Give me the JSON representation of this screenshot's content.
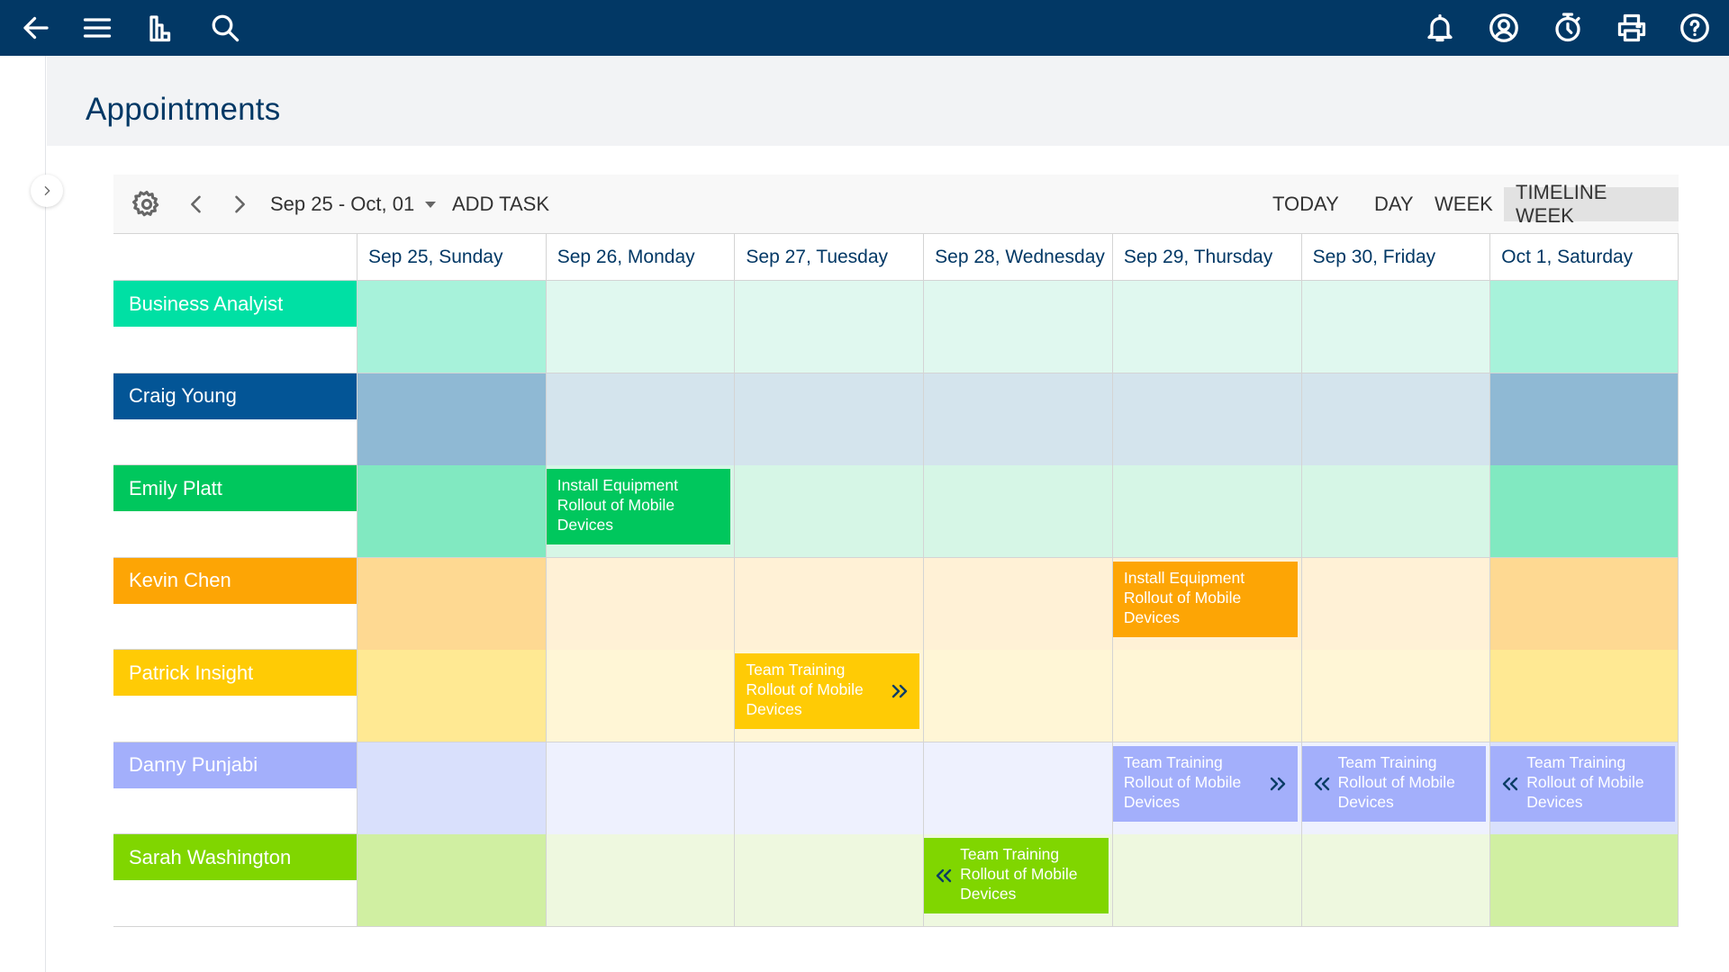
{
  "topbar": {
    "left_icons": [
      "back-arrow-icon",
      "menu-icon",
      "reports-icon",
      "search-icon"
    ],
    "right_icons": [
      "notifications-bell-icon",
      "user-profile-icon",
      "timer-icon",
      "print-icon",
      "help-icon"
    ]
  },
  "page": {
    "title": "Appointments"
  },
  "toolbar": {
    "date_range": "Sep 25 - Oct, 01",
    "add_task": "ADD TASK",
    "today": "TODAY",
    "views": [
      {
        "label": "DAY",
        "active": false
      },
      {
        "label": "WEEK",
        "active": false
      },
      {
        "label": "TIMELINE WEEK",
        "active": true
      }
    ]
  },
  "days": [
    "Sep 25, Sunday",
    "Sep 26, Monday",
    "Sep 27, Tuesday",
    "Sep 28, Wednesday",
    "Sep 29, Thursday",
    "Sep 30, Friday",
    "Oct 1, Saturday"
  ],
  "resources": [
    {
      "name": "Business Analyist",
      "color": "#00e0a4",
      "weekday_bg": "#e0f8ef",
      "weekend_bg": "#a7f2da"
    },
    {
      "name": "Craig Young",
      "color": "#035596",
      "weekday_bg": "#d4e4ed",
      "weekend_bg": "#8fb9d4"
    },
    {
      "name": "Emily Platt",
      "color": "#00c75d",
      "weekday_bg": "#d6f6e6",
      "weekend_bg": "#81e9c1"
    },
    {
      "name": "Kevin Chen",
      "color": "#fda505",
      "weekday_bg": "#fff1d6",
      "weekend_bg": "#fed992"
    },
    {
      "name": "Patrick Insight",
      "color": "#ffcb05",
      "weekday_bg": "#fff6d6",
      "weekend_bg": "#ffe993"
    },
    {
      "name": "Danny Punjabi",
      "color": "#a3affb",
      "weekday_bg": "#eef1fe",
      "weekend_bg": "#d9e0fc"
    },
    {
      "name": "Sarah Washington",
      "color": "#80d600",
      "weekday_bg": "#eef8df",
      "weekend_bg": "#d0efa2"
    }
  ],
  "events": [
    {
      "resource": 2,
      "day": 1,
      "line1": "Install Equipment",
      "line2": "Rollout of Mobile",
      "line3": "Devices",
      "continues_right": false,
      "continues_left": false
    },
    {
      "resource": 3,
      "day": 4,
      "line1": "Install Equipment",
      "line2": "Rollout of Mobile",
      "line3": "Devices",
      "continues_right": false,
      "continues_left": false
    },
    {
      "resource": 4,
      "day": 2,
      "line1": "Team Training",
      "line2": "Rollout of Mobile",
      "line3": "Devices",
      "continues_right": true,
      "continues_left": false
    },
    {
      "resource": 5,
      "day": 4,
      "line1": "Team Training",
      "line2": "Rollout of Mobile",
      "line3": "Devices",
      "continues_right": true,
      "continues_left": false
    },
    {
      "resource": 5,
      "day": 5,
      "line1": "Team Training",
      "line2": "Rollout of Mobile",
      "line3": "Devices",
      "continues_right": false,
      "continues_left": true
    },
    {
      "resource": 5,
      "day": 6,
      "line1": "Team Training",
      "line2": "Rollout of Mobile",
      "line3": "Devices",
      "continues_right": false,
      "continues_left": true
    },
    {
      "resource": 6,
      "day": 3,
      "line1": "Team Training",
      "line2": "Rollout of Mobile",
      "line3": "Devices",
      "continues_right": false,
      "continues_left": true
    }
  ]
}
